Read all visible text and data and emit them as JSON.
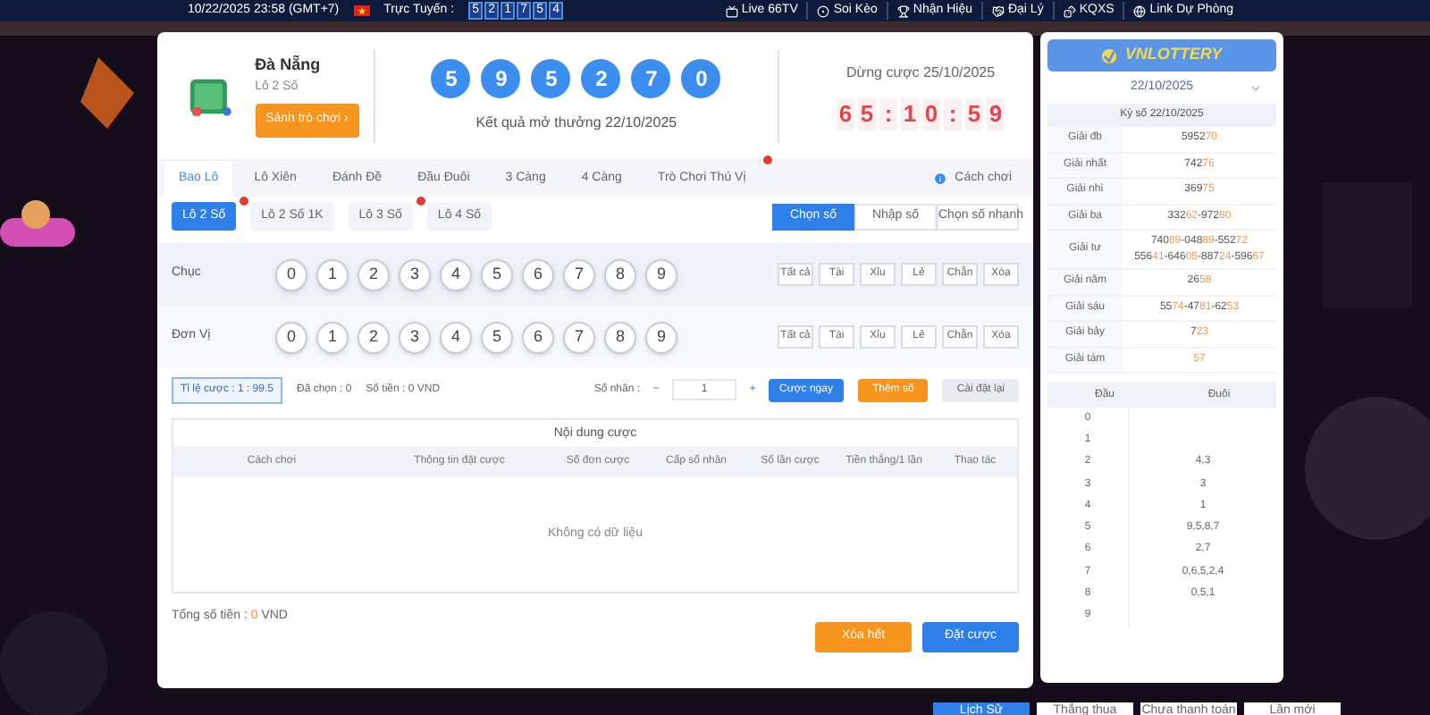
{
  "top_bar": {
    "datetime": "10/22/2025 23:58 (GMT+7)",
    "online_label": "Trực Tuyến :",
    "online_digits": [
      "5",
      "2",
      "1",
      "7",
      "5",
      "4"
    ],
    "links": [
      {
        "kind": "tv",
        "label": "Live 66TV"
      },
      {
        "kind": "ball",
        "label": "Soi Kèo"
      },
      {
        "kind": "trophy",
        "label": "Nhận Hiệu"
      },
      {
        "kind": "hand",
        "label": "Đại Lý"
      },
      {
        "kind": "dice",
        "label": "KQXS"
      },
      {
        "kind": "globe",
        "label": "Link Dự Phòng"
      }
    ]
  },
  "game": {
    "name": "Đà Nẵng",
    "type": "Lô 2 Số",
    "lobby_button": "Sảnh trò chơi ›",
    "result_balls": [
      "5",
      "9",
      "5",
      "2",
      "7",
      "0"
    ],
    "result_caption": "Kết quả mở thưởng 22/10/2025",
    "close_label": "Dừng cược 25/10/2025",
    "countdown": [
      "6",
      "5",
      ":",
      "1",
      "0",
      ":",
      "5",
      "9"
    ]
  },
  "tabs": [
    {
      "label": "Bao Lô",
      "selected": true,
      "badge": false
    },
    {
      "label": "Lô Xiên",
      "selected": false,
      "badge": false
    },
    {
      "label": "Đánh Đề",
      "selected": false,
      "badge": false
    },
    {
      "label": "Đầu Đuôi",
      "selected": false,
      "badge": false
    },
    {
      "label": "3 Càng",
      "selected": false,
      "badge": false
    },
    {
      "label": "4 Càng",
      "selected": false,
      "badge": false
    },
    {
      "label": "Trò Chơi Thú Vị",
      "selected": false,
      "badge": true
    }
  ],
  "how_to_play": "Cách chơi",
  "subtabs": [
    {
      "label": "Lô 2 Số",
      "selected": true,
      "badge": true
    },
    {
      "label": "Lô 2 Số 1K",
      "selected": false,
      "badge": false
    },
    {
      "label": "Lô 3 Số",
      "selected": false,
      "badge": true
    },
    {
      "label": "Lô 4 Số",
      "selected": false,
      "badge": false
    }
  ],
  "modes": [
    {
      "label": "Chọn số",
      "selected": true
    },
    {
      "label": "Nhập số",
      "selected": false
    },
    {
      "label": "Chọn số nhanh",
      "selected": false
    }
  ],
  "pick_rows": [
    {
      "label": "Chục",
      "digits": [
        "0",
        "1",
        "2",
        "3",
        "4",
        "5",
        "6",
        "7",
        "8",
        "9"
      ],
      "quick": [
        "Tất cả",
        "Tài",
        "Xỉu",
        "Lẻ",
        "Chẵn",
        "Xóa"
      ]
    },
    {
      "label": "Đơn Vị",
      "digits": [
        "0",
        "1",
        "2",
        "3",
        "4",
        "5",
        "6",
        "7",
        "8",
        "9"
      ],
      "quick": [
        "Tất cả",
        "Tài",
        "Xỉu",
        "Lẻ",
        "Chẵn",
        "Xóa"
      ]
    }
  ],
  "bet_bar": {
    "odds": "Tỉ lệ cược : 1 : 99.5",
    "selected_count": "Đã chọn : 0",
    "amount": "Số tiền : 0 VND",
    "multiplier_label": "Số nhân :",
    "minus": "−",
    "multiplier": "1",
    "plus": "+",
    "bet_now": "Cược ngay",
    "add": "Thêm số",
    "reset": "Cài đặt lại"
  },
  "bet_table": {
    "title": "Nội dung cược",
    "columns": [
      "Cách chơi",
      "Thông tin đặt cược",
      "Số đơn cược",
      "Cấp số nhân",
      "Số lần cược",
      "Tiền thắng/1 lần",
      "Thao tác"
    ],
    "empty": "Không có dữ liệu"
  },
  "total": {
    "label": "Tổng số tiền : ",
    "value": "0",
    "unit": " VND"
  },
  "actions": {
    "clear": "Xóa hết",
    "place": "Đặt cược"
  },
  "results": {
    "logo": "VNLOTTERY",
    "date": "22/10/2025",
    "draw": "Kỳ số 22/10/2025",
    "prizes": [
      {
        "label": "Giải đb",
        "lines": [
          [
            {
              "head": "5952",
              "tail": "70"
            }
          ]
        ]
      },
      {
        "label": "Giải nhất",
        "lines": [
          [
            {
              "head": "742",
              "tail": "76"
            }
          ]
        ]
      },
      {
        "label": "Giải nhì",
        "lines": [
          [
            {
              "head": "369",
              "tail": "75"
            }
          ]
        ]
      },
      {
        "label": "Giải ba",
        "lines": [
          [
            {
              "head": "332",
              "tail": "62"
            },
            {
              "sep": "-",
              "head": "972",
              "tail": "80"
            }
          ]
        ]
      },
      {
        "label": "Giải tư",
        "lines": [
          [
            {
              "head": "740",
              "tail": "89"
            },
            {
              "sep": "-",
              "head": "048",
              "tail": "89"
            },
            {
              "sep": "-",
              "head": "552",
              "tail": "72"
            }
          ],
          [
            {
              "head": "556",
              "tail": "41"
            },
            {
              "sep": "-",
              "head": "646",
              "tail": "05"
            },
            {
              "sep": "-",
              "head": "887",
              "tail": "24"
            },
            {
              "sep": "-",
              "head": "596",
              "tail": "67"
            }
          ]
        ]
      },
      {
        "label": "Giải năm",
        "lines": [
          [
            {
              "head": "26",
              "tail": "58"
            }
          ]
        ]
      },
      {
        "label": "Giải sáu",
        "lines": [
          [
            {
              "head": "55",
              "tail": "74"
            },
            {
              "sep": "-",
              "head": "47",
              "tail": "81"
            },
            {
              "sep": "-",
              "head": "62",
              "tail": "53"
            }
          ]
        ]
      },
      {
        "label": "Giải bảy",
        "lines": [
          [
            {
              "head": "7",
              "tail": "23"
            }
          ]
        ]
      },
      {
        "label": "Giải tám",
        "lines": [
          [
            {
              "tail": "57"
            }
          ]
        ]
      }
    ],
    "head_tail": {
      "columns": [
        "Đầu",
        "Đuôi"
      ],
      "rows": [
        {
          "head": "0"
        },
        {
          "head": "1"
        },
        {
          "head": "2",
          "tail": "4,3"
        },
        {
          "head": "3",
          "tail": "3"
        },
        {
          "head": "4",
          "tail": "1"
        },
        {
          "head": "5",
          "tail": "9,5,8,7"
        },
        {
          "head": "6",
          "tail": "2,7"
        },
        {
          "head": "7",
          "tail": "0,6,5,2,4"
        },
        {
          "head": "8",
          "tail": "0,5,1"
        },
        {
          "head": "9"
        }
      ]
    }
  },
  "history_tabs": [
    {
      "label": "Lịch Sử",
      "selected": true
    },
    {
      "label": "Thắng thua",
      "selected": false
    },
    {
      "label": "Chưa thanh toán",
      "selected": false
    },
    {
      "label": "Lần mới",
      "selected": false
    }
  ]
}
